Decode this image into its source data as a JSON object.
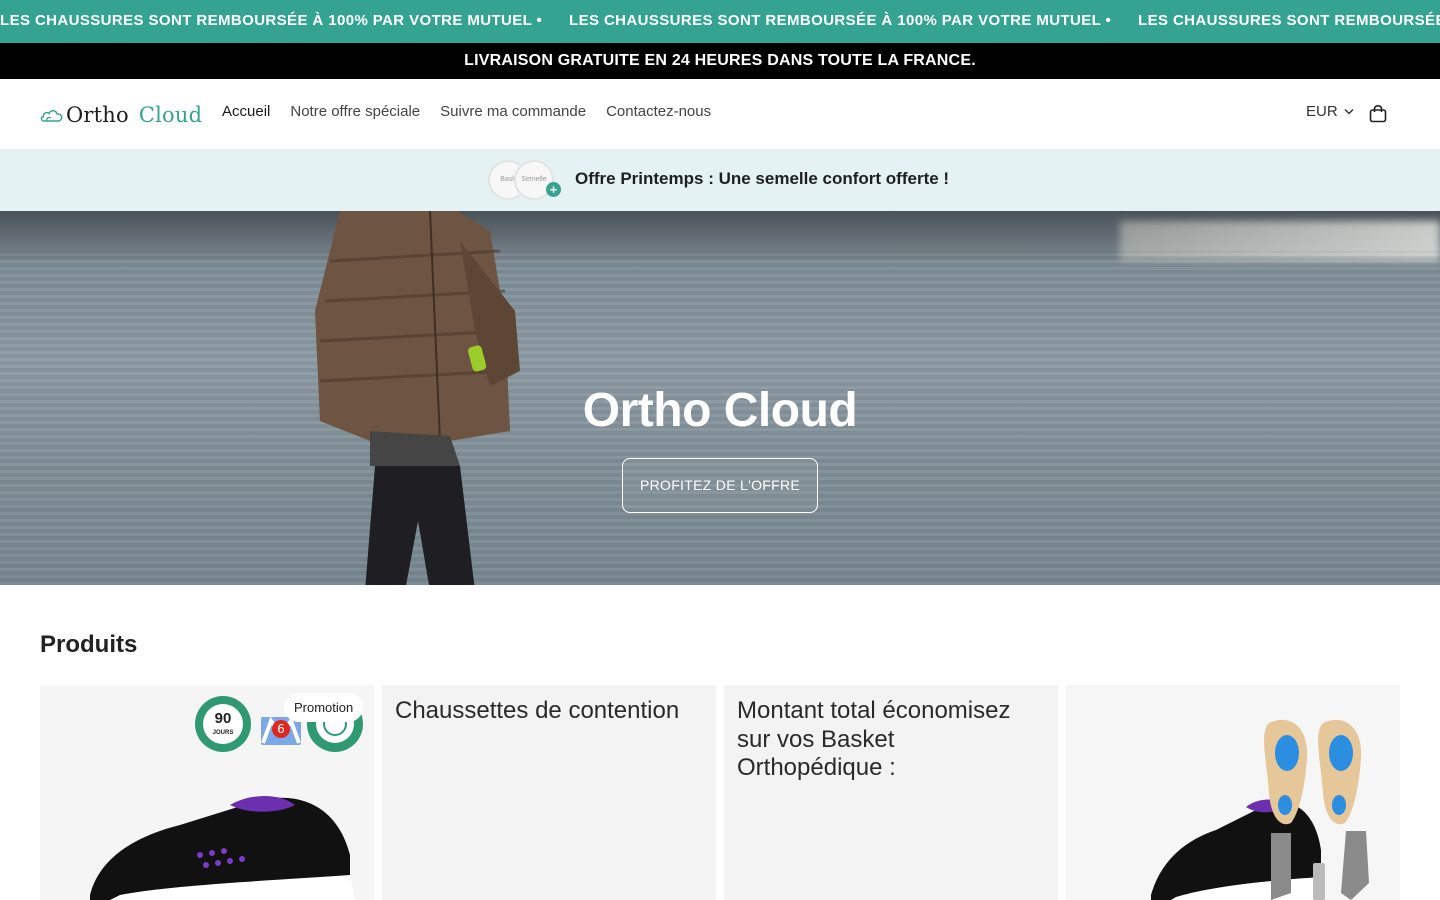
{
  "announcement": {
    "marquee_text": "LES CHAUSSURES SONT REMBOURSÉE À 100% PAR VOTRE MUTUEL •",
    "marquee_text_partial": "LES CHAUSSURES SONT REMBOURSÉE",
    "delivery_text": "LIVRAISON GRATUITE EN 24 HEURES DANS TOUTE LA FRANCE.",
    "bg_color": "#35a392"
  },
  "header": {
    "logo": {
      "part1": "Ortho",
      "part2": "Cloud"
    },
    "nav": [
      {
        "label": "Accueil",
        "active": true
      },
      {
        "label": "Notre offre spéciale",
        "active": false
      },
      {
        "label": "Suivre ma commande",
        "active": false
      },
      {
        "label": "Contactez-nous",
        "active": false
      }
    ],
    "currency": "EUR",
    "cart_icon": "shopping-bag-icon"
  },
  "offer_banner": {
    "thumb1_label": "Bask",
    "thumb2_label": "Semelle",
    "plus": "+",
    "text": "Offre Printemps : Une semelle confort offerte !"
  },
  "hero": {
    "title": "Ortho Cloud",
    "button_label": "PROFITEZ DE L'OFFRE"
  },
  "products": {
    "title": "Produits",
    "cards": [
      {
        "type": "image",
        "badge": "Promotion",
        "seal_number": "90",
        "seal_label": "JOURS"
      },
      {
        "type": "text",
        "text": "Chaussettes de contention"
      },
      {
        "type": "text",
        "text": "Montant total économisez sur vos Basket Orthopédique :"
      },
      {
        "type": "image"
      }
    ]
  }
}
